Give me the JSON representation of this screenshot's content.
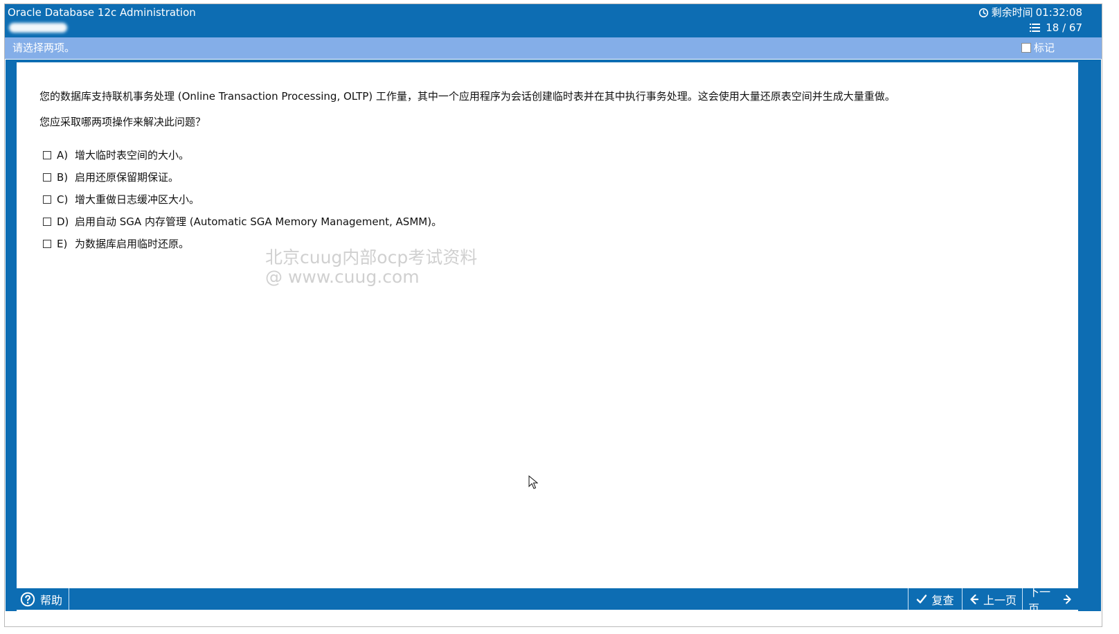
{
  "window": {
    "title": "Oracle Database 12c Administration"
  },
  "header": {
    "timer_label": "剩余时间",
    "timer_value": "01:32:08",
    "progress": "18 / 67",
    "clock_icon": "clock-icon",
    "list_icon": "list-icon"
  },
  "instruction": {
    "text": "请选择两项。",
    "mark_label": "标记"
  },
  "question": {
    "text": "您的数据库支持联机事务处理 (Online Transaction Processing, OLTP) 工作量，其中一个应用程序为会话创建临时表并在其中执行事务处理。这会使用大量还原表空间并生成大量重做。",
    "prompt": "您应采取哪两项操作来解决此问题？",
    "options": [
      {
        "label": "A)",
        "text": "增大临时表空间的大小。"
      },
      {
        "label": "B)",
        "text": "启用还原保留期保证。"
      },
      {
        "label": "C)",
        "text": "增大重做日志缓冲区大小。"
      },
      {
        "label": "D)",
        "text": "启用自动 SGA 内存管理 (Automatic SGA Memory Management, ASMM)。"
      },
      {
        "label": "E)",
        "text": "为数据库启用临时还原。"
      }
    ]
  },
  "watermark": {
    "line1": "北京cuug内部ocp考试资料",
    "line2": "@ www.cuug.com"
  },
  "footer": {
    "help_label": "帮助",
    "review_label": "复查",
    "prev_label": "上一页",
    "next_label": "下一页",
    "help_icon": "question-mark-icon",
    "review_icon": "check-icon",
    "prev_icon": "arrow-left-icon",
    "next_icon": "arrow-right-icon"
  },
  "colors": {
    "primary": "#0d6db3",
    "instruction_bar": "#84aee8",
    "watermark": "#d0d0d0"
  }
}
